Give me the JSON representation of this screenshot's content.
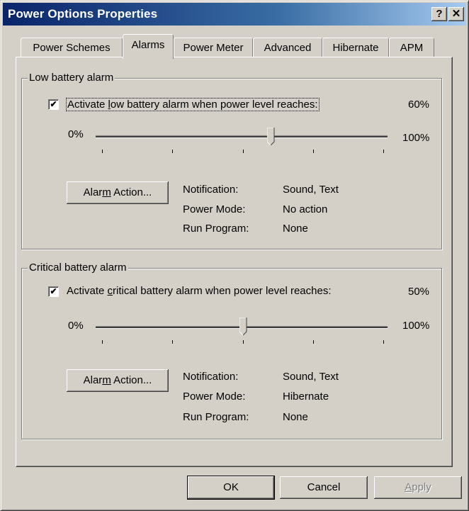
{
  "window": {
    "title": "Power Options Properties",
    "help_glyph": "?",
    "close_glyph": "✕"
  },
  "tabs": [
    {
      "label": "Power Schemes"
    },
    {
      "label": "Alarms"
    },
    {
      "label": "Power Meter"
    },
    {
      "label": "Advanced"
    },
    {
      "label": "Hibernate"
    },
    {
      "label": "APM"
    }
  ],
  "low_alarm": {
    "group_title": "Low battery alarm",
    "checked": true,
    "check_pre": "Activate ",
    "check_u": "l",
    "check_post": "ow battery alarm when power level reaches:",
    "level_text": "60%",
    "level_value": 60,
    "min_label": "0%",
    "max_label": "100%",
    "action_pre": "Alar",
    "action_u": "m",
    "action_post": " Action...",
    "notification_label": "Notification:",
    "notification_value": "Sound, Text",
    "power_mode_label": "Power Mode:",
    "power_mode_value": "No action",
    "run_program_label": "Run Program:",
    "run_program_value": "None"
  },
  "critical_alarm": {
    "group_title": "Critical battery alarm",
    "checked": true,
    "check_pre": "Activate ",
    "check_u": "c",
    "check_post": "ritical battery alarm when power level reaches:",
    "level_text": "50%",
    "level_value": 50,
    "min_label": "0%",
    "max_label": "100%",
    "action_pre": "Alar",
    "action_u": "m",
    "action_post": " Action...",
    "notification_label": "Notification:",
    "notification_value": "Sound, Text",
    "power_mode_label": "Power Mode:",
    "power_mode_value": "Hibernate",
    "run_program_label": "Run Program:",
    "run_program_value": "None"
  },
  "footer": {
    "ok": "OK",
    "cancel": "Cancel",
    "apply_u": "A",
    "apply_post": "pply"
  }
}
